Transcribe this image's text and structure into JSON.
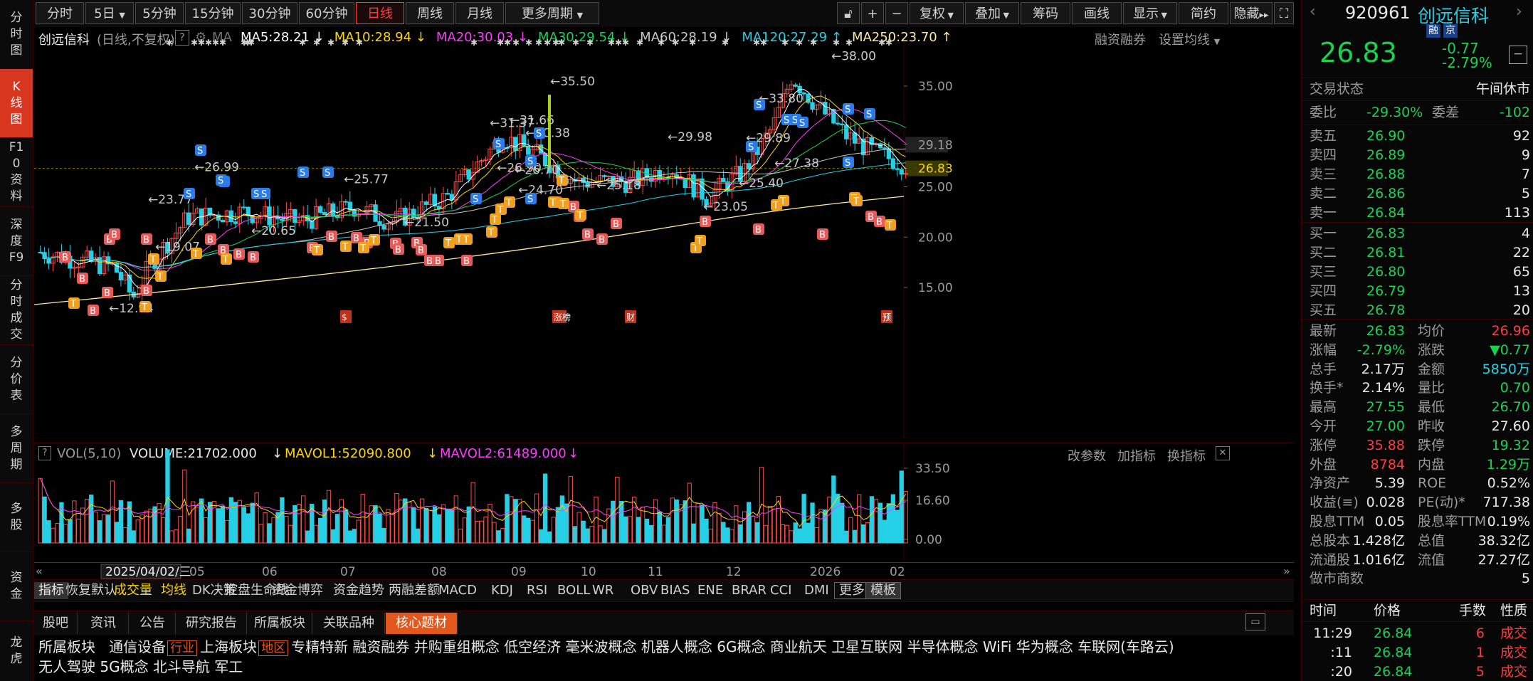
{
  "left_nav": [
    {
      "label": "分时图"
    },
    {
      "label": "K线图"
    },
    {
      "label": "F10资料"
    },
    {
      "label": "深度F9"
    },
    {
      "label": "分时成交"
    },
    {
      "label": "分价表"
    },
    {
      "label": "多周期"
    },
    {
      "label": "多股"
    },
    {
      "label": "资金"
    },
    {
      "label": "龙虎"
    }
  ],
  "toolbar": {
    "periods": [
      "分时",
      "5日",
      "5分钟",
      "15分钟",
      "30分钟",
      "60分钟",
      "日线",
      "周线",
      "月线",
      "更多周期"
    ],
    "active_period": "日线",
    "tools": [
      "复权",
      "叠加",
      "筹码",
      "画线",
      "显示",
      "简约",
      "隐藏"
    ],
    "window_icons": [
      "lock-icon",
      "plus-icon",
      "minus-icon",
      "expand-icon"
    ]
  },
  "chart_header": {
    "name": "创远信科",
    "mode": "(日线,不复权)",
    "help": "?",
    "ma_prefix": "MA",
    "ma": [
      {
        "label": "MA5:28.21",
        "arrow": "↓",
        "color": "#ffffff"
      },
      {
        "label": "MA10:28.94",
        "arrow": "↓",
        "color": "#ffd400"
      },
      {
        "label": "MA20:30.03",
        "arrow": "↓",
        "color": "#ff3bff"
      },
      {
        "label": "MA30:29.54",
        "arrow": "↓",
        "color": "#19d24f"
      },
      {
        "label": "MA60:28.19",
        "arrow": "↓",
        "color": "#c8c8c8"
      },
      {
        "label": "MA120:27.29",
        "arrow": "↑",
        "color": "#25d0e6"
      },
      {
        "label": "MA250:23.70",
        "arrow": "↑",
        "color": "#ffe7a0"
      }
    ],
    "right_links": [
      "融资融券",
      "设置均线"
    ]
  },
  "chart_data": {
    "type": "candlestick",
    "y_ticks": [
      "35.00",
      "29.18",
      "26.83",
      "25.00",
      "20.00",
      "15.00"
    ],
    "current_price_label": "26.83",
    "prev_close_label": "29.18",
    "annotations": [
      "38.00",
      "35.50",
      "33.80",
      "31.37",
      "31.66",
      "30.38",
      "29.98",
      "29.89",
      "27.38",
      "26.99",
      "26.90",
      "26.70",
      "25.77",
      "25.40",
      "25.18",
      "24.70",
      "23.77",
      "23.05",
      "21.50",
      "20.65",
      "19.07",
      "12.94"
    ],
    "x_ticks": [
      "2025/04/02/三",
      "05",
      "06",
      "07",
      "08",
      "09",
      "10",
      "11",
      "12",
      "2026",
      "02"
    ],
    "vol_ticks": [
      "33.50",
      "16.60",
      "0.00"
    ],
    "events": [
      "$",
      "涨榜",
      "财",
      "预"
    ]
  },
  "vol_header": {
    "name": "VOL(5,10)",
    "volume": "VOLUME:21702.000",
    "mavol1": "MAVOL1:52090.800",
    "mavol2": "MAVOL2:61489.000",
    "arrow": "↓",
    "links": [
      "改参数",
      "加指标",
      "换指标"
    ]
  },
  "indicator_tabs": [
    "指标",
    "恢复默认",
    "成交量",
    "均线",
    "DK决策",
    "控盘生命线",
    "资金博弈",
    "资金趋势",
    "两融差额",
    "MACD",
    "KDJ",
    "RSI",
    "BOLL",
    "WR",
    "OBV",
    "BIAS",
    "ENE",
    "BRAR",
    "CCI",
    "DMI",
    "更多",
    "模板"
  ],
  "bottom_tabs": [
    "股吧",
    "资讯",
    "公告",
    "研究报告",
    "所属板块",
    "关联品种",
    "核心题材"
  ],
  "active_bottom_tab": "核心题材",
  "concepts": {
    "label": "所属板块",
    "industry": "通信设备",
    "industry_tag": "行业",
    "region": "上海板块",
    "region_tag": "地区",
    "items_line1": "专精特新  融资融券  并购重组概念  低空经济  毫米波概念  机器人概念  6G概念  商业航天  卫星互联网  半导体概念  WiFi  华为概念  车联网(车路云)",
    "items_line2": "无人驾驶  5G概念  北斗导航  军工"
  },
  "quote": {
    "code": "920961",
    "name": "创远信科",
    "badges": [
      "融",
      "京"
    ],
    "price": "26.83",
    "change": "-0.77",
    "change_pct": "-2.79%",
    "status_label": "交易状态",
    "status_value": "午间休市",
    "webi_label": "委比",
    "webi": "-29.30%",
    "weicha_label": "委差",
    "weicha": "-102",
    "asks": [
      {
        "label": "卖五",
        "price": "26.90",
        "vol": "92"
      },
      {
        "label": "卖四",
        "price": "26.89",
        "vol": "9"
      },
      {
        "label": "卖三",
        "price": "26.88",
        "vol": "7"
      },
      {
        "label": "卖二",
        "price": "26.86",
        "vol": "5"
      },
      {
        "label": "卖一",
        "price": "26.84",
        "vol": "113"
      }
    ],
    "bids": [
      {
        "label": "买一",
        "price": "26.83",
        "vol": "4"
      },
      {
        "label": "买二",
        "price": "26.81",
        "vol": "22"
      },
      {
        "label": "买三",
        "price": "26.80",
        "vol": "65"
      },
      {
        "label": "买四",
        "price": "26.79",
        "vol": "13"
      },
      {
        "label": "买五",
        "price": "26.78",
        "vol": "20"
      }
    ],
    "stats": [
      {
        "l1": "最新",
        "v1": "26.83",
        "c1": "green",
        "l2": "均价",
        "v2": "26.96",
        "c2": "red"
      },
      {
        "l1": "涨幅",
        "v1": "-2.79%",
        "c1": "green",
        "l2": "涨跌",
        "v2": "▼0.77",
        "c2": "green"
      },
      {
        "l1": "总手",
        "v1": "2.17万",
        "c1": "white",
        "l2": "金额",
        "v2": "5850万",
        "c2": "cyan"
      },
      {
        "l1": "换手*",
        "v1": "2.14%",
        "c1": "white",
        "l2": "量比",
        "v2": "0.70",
        "c2": "green"
      },
      {
        "l1": "最高",
        "v1": "27.55",
        "c1": "green",
        "l2": "最低",
        "v2": "26.70",
        "c2": "green"
      },
      {
        "l1": "今开",
        "v1": "27.00",
        "c1": "green",
        "l2": "昨收",
        "v2": "27.60",
        "c2": "white"
      },
      {
        "l1": "涨停",
        "v1": "35.88",
        "c1": "red",
        "l2": "跌停",
        "v2": "19.32",
        "c2": "green"
      },
      {
        "l1": "外盘",
        "v1": "8784",
        "c1": "red",
        "l2": "内盘",
        "v2": "1.29万",
        "c2": "green"
      },
      {
        "l1": "净资产",
        "v1": "5.39",
        "c1": "white",
        "l2": "ROE",
        "v2": "0.52%",
        "c2": "white"
      },
      {
        "l1": "收益(≡)",
        "v1": "0.028",
        "c1": "white",
        "l2": "PE(动)*",
        "v2": "717.38",
        "c2": "white"
      },
      {
        "l1": "股息TTM",
        "v1": "0.05",
        "c1": "white",
        "l2": "股息率TTM",
        "v2": "0.19%",
        "c2": "white"
      },
      {
        "l1": "总股本",
        "v1": "1.428亿",
        "c1": "white",
        "l2": "总值",
        "v2": "38.32亿",
        "c2": "white"
      },
      {
        "l1": "流通股",
        "v1": "1.016亿",
        "c1": "white",
        "l2": "流值",
        "v2": "27.27亿",
        "c2": "white"
      },
      {
        "l1": "做市商数",
        "v1": "",
        "c1": "white",
        "l2": "",
        "v2": "5",
        "c2": "white"
      }
    ],
    "ticks_header": [
      "时间",
      "价格",
      "手数",
      "性质"
    ],
    "ticks": [
      {
        "time": "11:29",
        "price": "26.84",
        "vol": "6",
        "type": "成交"
      },
      {
        "time": ":11",
        "price": "26.84",
        "vol": "1",
        "type": "成交"
      },
      {
        "time": ":20",
        "price": "26.84",
        "vol": "5",
        "type": "成交"
      }
    ]
  }
}
